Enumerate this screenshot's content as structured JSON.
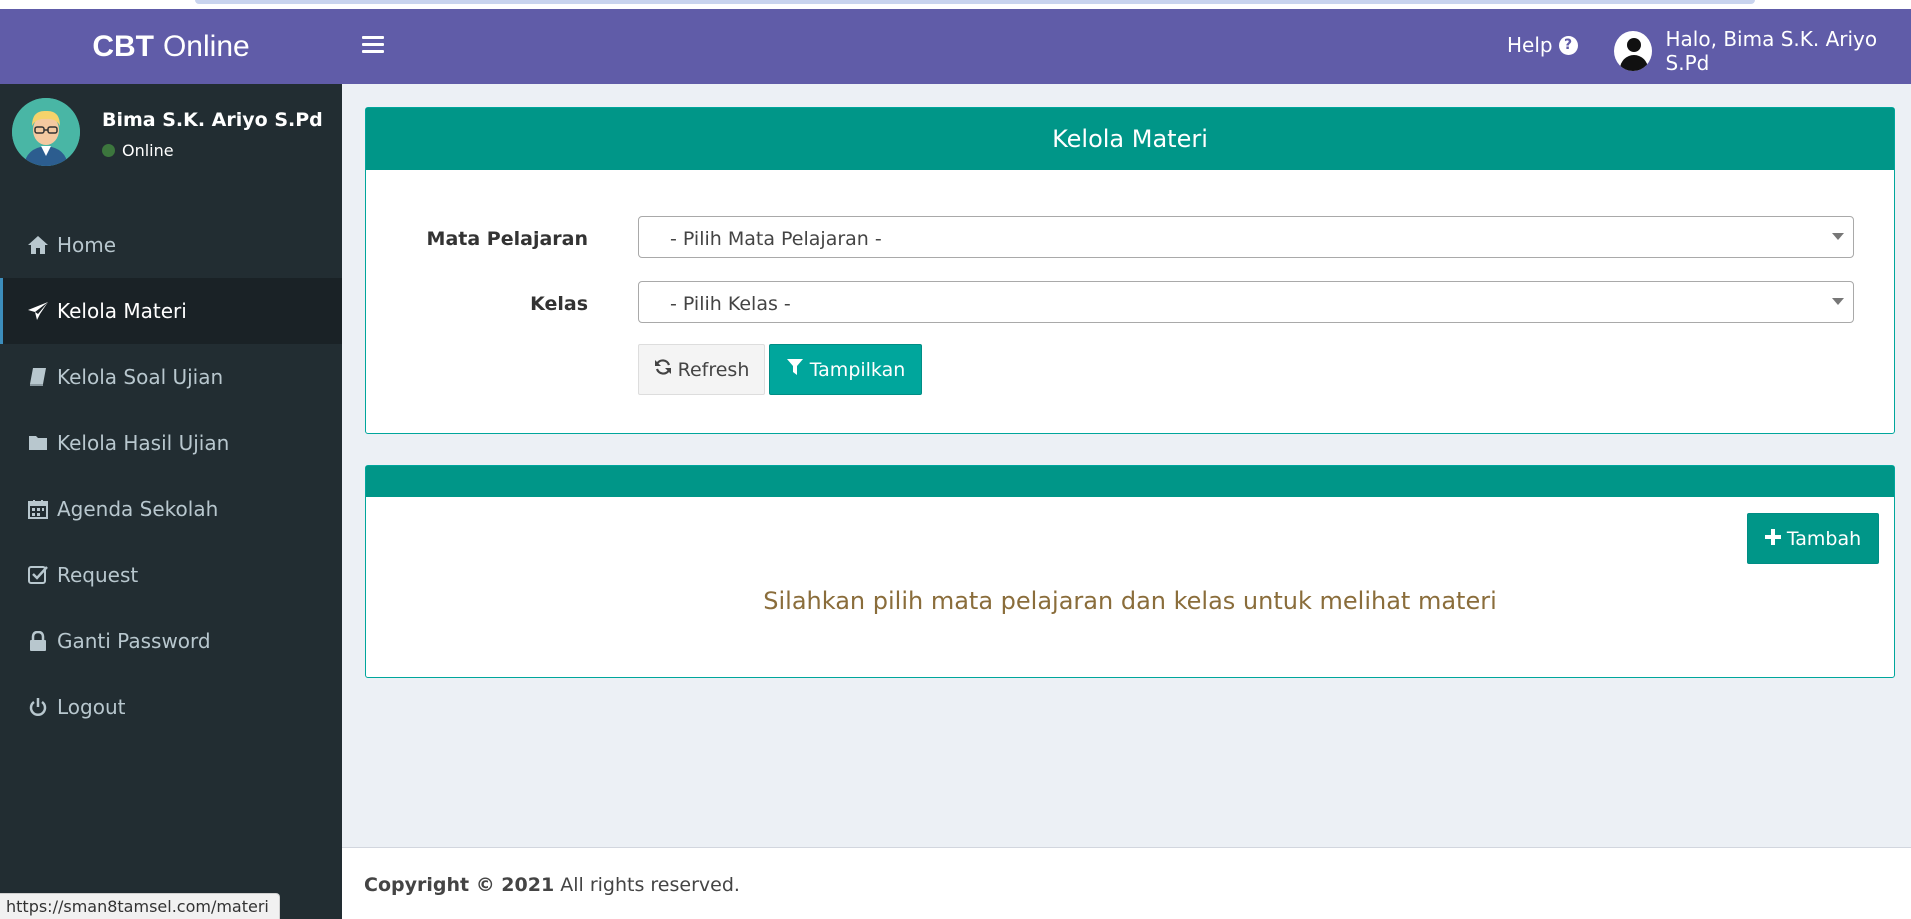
{
  "header": {
    "logo_bold": "CBT",
    "logo_rest": "Online",
    "help_label": "Help",
    "user_greeting": "Halo, Bima S.K. Ariyo S.Pd",
    "colors": {
      "navbar": "#605ca8"
    }
  },
  "sidebar": {
    "user_name": "Bima S.K. Ariyo S.Pd",
    "user_status": "Online",
    "items": [
      {
        "label": "Home",
        "icon": "home-icon"
      },
      {
        "label": "Kelola Materi",
        "icon": "paper-plane-icon",
        "active": true
      },
      {
        "label": "Kelola Soal Ujian",
        "icon": "book-icon"
      },
      {
        "label": "Kelola Hasil Ujian",
        "icon": "folder-icon"
      },
      {
        "label": "Agenda Sekolah",
        "icon": "calendar-icon"
      },
      {
        "label": "Request",
        "icon": "check-square-icon"
      },
      {
        "label": "Ganti Password",
        "icon": "lock-icon"
      },
      {
        "label": "Logout",
        "icon": "power-icon"
      }
    ]
  },
  "filter_box": {
    "title": "Kelola Materi",
    "subject_label": "Mata Pelajaran",
    "subject_value": "- Pilih Mata Pelajaran -",
    "class_label": "Kelas",
    "class_value": "- Pilih Kelas -",
    "refresh_label": "Refresh",
    "show_label": "Tampilkan"
  },
  "result_box": {
    "add_label": "Tambah",
    "empty_message": "Silahkan pilih mata pelajaran dan kelas untuk melihat materi"
  },
  "footer": {
    "copyright": "Copyright © 2021",
    "rights": "All rights reserved."
  },
  "status_url": "https://sman8tamsel.com/materi",
  "colors": {
    "accent": "#009688",
    "sidebar": "#222d32",
    "message": "#8a6d3b"
  }
}
